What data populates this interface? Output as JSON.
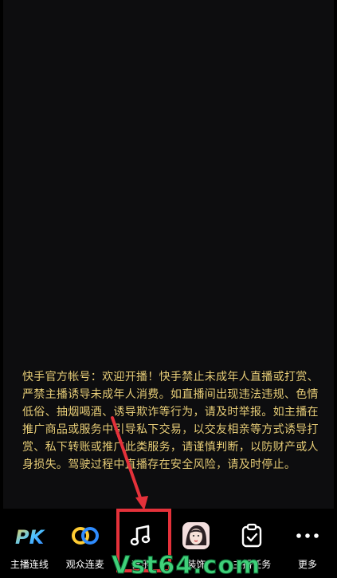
{
  "notice": {
    "text": "快手官方帐号：欢迎开播！快手禁止未成年人直播或打赏、严禁主播诱导未成年人消费。如直播间出现违法违规、色情低俗、抽烟喝酒、诱导欺诈等行为，请及时举报。如主播在推广商品或服务中引导私下交易，以交友相亲等方式诱导打赏、私下转账或推广此类服务，请谨慎判断，以防财产或人身损失。驾驶过程中直播存在安全风险，请及时停止。"
  },
  "toolbar": {
    "items": [
      {
        "label": "主播连线",
        "icon": "pk-icon"
      },
      {
        "label": "观众连麦",
        "icon": "link-rings-icon"
      },
      {
        "label": "音乐",
        "icon": "music-note-icon"
      },
      {
        "label": "装饰",
        "icon": "beauty-avatar-icon"
      },
      {
        "label": "主播任务",
        "icon": "task-clipboard-icon"
      },
      {
        "label": "更多",
        "icon": "more-dots-icon"
      }
    ]
  },
  "watermark": "Vst64.com",
  "colors": {
    "background": "#0d0d0f",
    "notice_text": "#e9cf7a",
    "highlight": "#e4313a",
    "watermark": "#3fd07a"
  }
}
